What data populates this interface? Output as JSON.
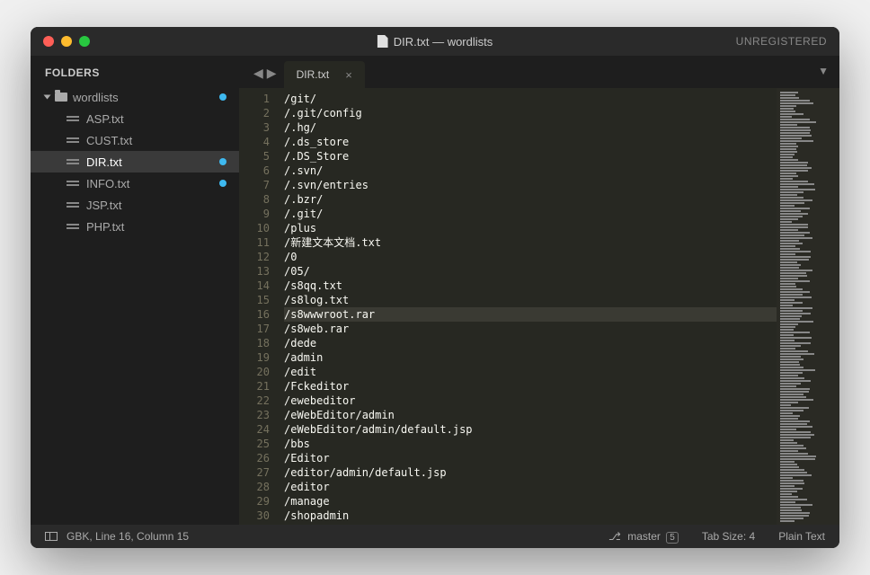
{
  "titlebar": {
    "title": "DIR.txt — wordlists",
    "unregistered": "UNREGISTERED"
  },
  "sidebar": {
    "header": "FOLDERS",
    "folder": {
      "name": "wordlists",
      "modified": true
    },
    "files": [
      {
        "name": "ASP.txt",
        "modified": false,
        "selected": false
      },
      {
        "name": "CUST.txt",
        "modified": false,
        "selected": false
      },
      {
        "name": "DIR.txt",
        "modified": true,
        "selected": true
      },
      {
        "name": "INFO.txt",
        "modified": true,
        "selected": false
      },
      {
        "name": "JSP.txt",
        "modified": false,
        "selected": false
      },
      {
        "name": "PHP.txt",
        "modified": false,
        "selected": false
      }
    ]
  },
  "tabs": {
    "active": {
      "label": "DIR.txt"
    }
  },
  "editor": {
    "highlighted_line": 16,
    "lines": [
      "/git/",
      "/.git/config",
      "/.hg/",
      "/.ds_store",
      "/.DS_Store",
      "/.svn/",
      "/.svn/entries",
      "/.bzr/",
      "/.git/",
      "/plus",
      "/新建文本文档.txt",
      "/0",
      "/05/",
      "/s8qq.txt",
      "/s8log.txt",
      "/s8wwwroot.rar",
      "/s8web.rar",
      "/dede",
      "/admin",
      "/edit",
      "/Fckeditor",
      "/ewebeditor",
      "/eWebEditor/admin",
      "/eWebEditor/admin/default.jsp",
      "/bbs",
      "/Editor",
      "/editor/admin/default.jsp",
      "/editor",
      "/manage",
      "/shopadmin"
    ]
  },
  "statusbar": {
    "encoding": "GBK, Line 16, Column 15",
    "branch": "master",
    "branch_count": "5",
    "tab_size": "Tab Size: 4",
    "syntax": "Plain Text"
  }
}
